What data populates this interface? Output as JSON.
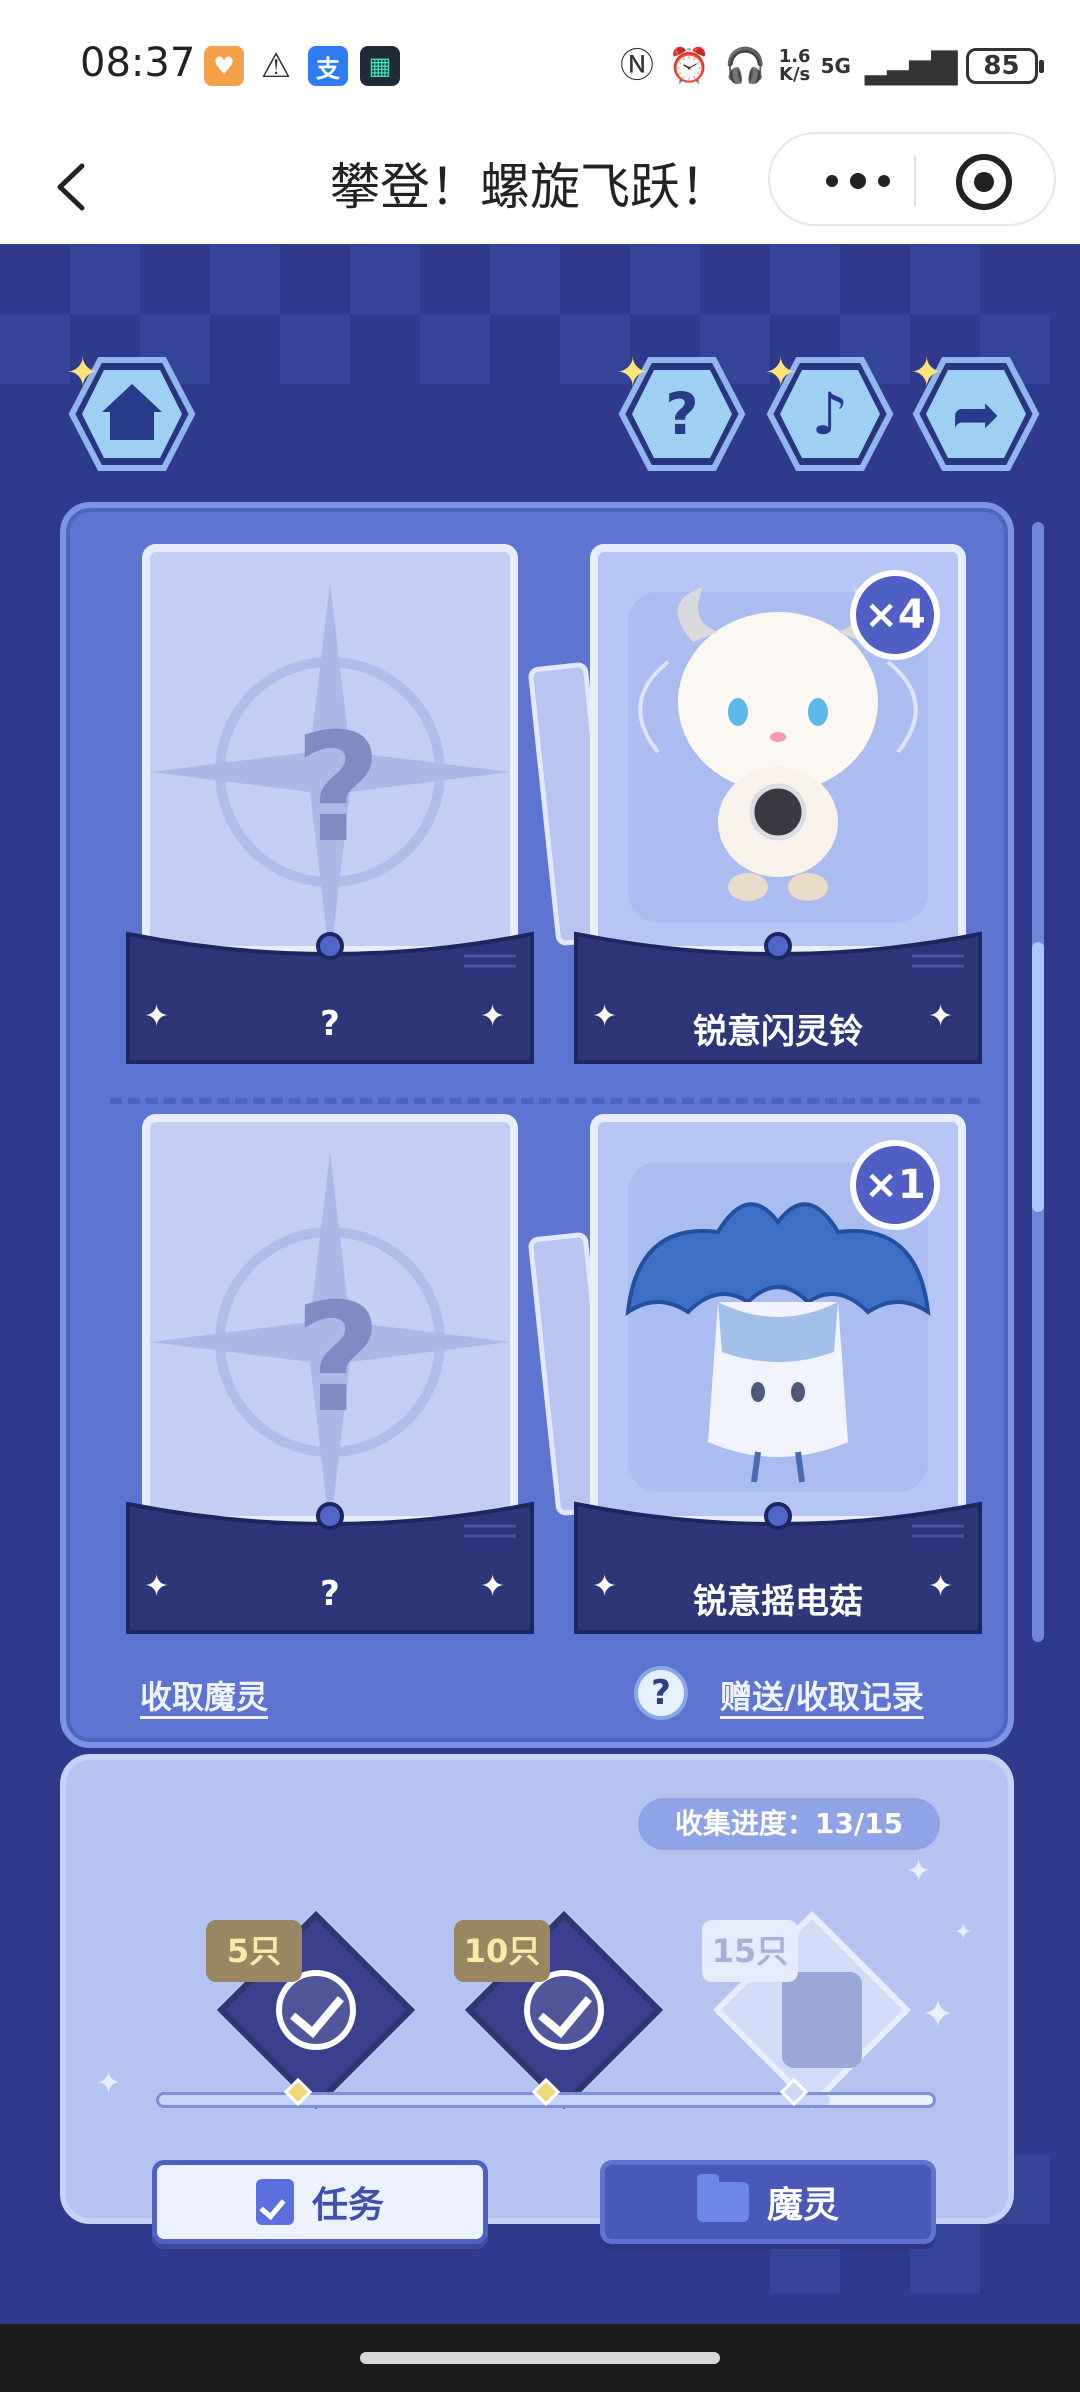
{
  "status_bar": {
    "time": "08:37",
    "network": "5G",
    "speed_value": "1.6",
    "speed_unit": "K/s",
    "battery": "85"
  },
  "header": {
    "title": "攀登！螺旋飞跃！"
  },
  "nav_buttons": {
    "home": "home-icon",
    "help": "?",
    "music": "music-icon",
    "share": "share-icon"
  },
  "cards": [
    {
      "name": "?",
      "count": null
    },
    {
      "name": "锐意闪灵铃",
      "count": "×4"
    },
    {
      "name": "?",
      "count": null
    },
    {
      "name": "锐意摇电菇",
      "count": "×1"
    }
  ],
  "card_placeholder": "?",
  "links": {
    "collect": "收取魔灵",
    "records_help": "?",
    "records": "赠送/收取记录"
  },
  "collection": {
    "progress_label": "收集进度：",
    "progress_value": "13/15",
    "progress_fraction": 0.867,
    "milestones": [
      {
        "label": "5只",
        "done": true
      },
      {
        "label": "10只",
        "done": true
      },
      {
        "label": "15只",
        "done": false
      }
    ]
  },
  "buttons": {
    "task": "任务",
    "spirit": "魔灵"
  },
  "colors": {
    "background": "#2f3a8c",
    "panel": "#5d75d0",
    "accent": "#4a58b8"
  }
}
